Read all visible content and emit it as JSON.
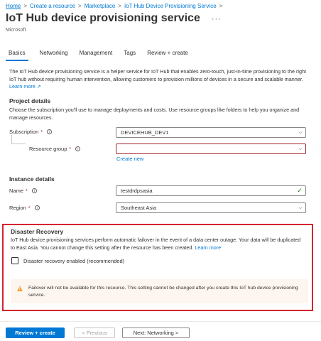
{
  "breadcrumb": {
    "items": [
      "Home",
      "Create a resource",
      "Marketplace",
      "IoT Hub Device Provisioning Service"
    ],
    "separator": ">"
  },
  "header": {
    "title": "IoT Hub device provisioning service",
    "more": "···",
    "subtitle": "Microsoft"
  },
  "tabs": [
    "Basics",
    "Networking",
    "Management",
    "Tags",
    "Review + create"
  ],
  "intro": {
    "text": "The IoT Hub device provisioning service is a helper service for IoT Hub that enables zero-touch, just-in-time provisioning to the right IoT hub without requiring human intervention, allowing customers to provision millions of devices in a secure and scalable manner.",
    "link": "Learn more"
  },
  "project": {
    "title": "Project details",
    "desc": "Choose the subscription you'll use to manage deployments and costs. Use resource groups like folders to help you organize and manage resources.",
    "subscription_label": "Subscription",
    "subscription_value": "DEVICEHUB_DEV1",
    "resource_group_label": "Resource group",
    "resource_group_value": "",
    "create_new": "Create new"
  },
  "instance": {
    "title": "Instance details",
    "name_label": "Name",
    "name_value": "testdrdpsasia",
    "region_label": "Region",
    "region_value": "Southeast Asia"
  },
  "disaster_recovery": {
    "title": "Disaster Recovery",
    "desc": "IoT Hub device provisioning services perform automatic failover in the event of a data center outage. Your data will be duplicated to East Asia. You cannot change this setting after the resource has been created.",
    "link": "Learn more",
    "checkbox_label": "Disaster recovery enabled (recommended)",
    "warning": "Failover will not be available for this resource. This setting cannot be changed after you create this IoT hub device provisioning service."
  },
  "footer": {
    "review_create": "Review + create",
    "previous": "< Previous",
    "next": "Next: Networking >"
  },
  "colors": {
    "accent": "#0078d4",
    "highlight_border": "#d3232f",
    "warning_bg": "#fdf6f0",
    "warning_icon": "#f7a23a",
    "required": "#a4262c"
  }
}
